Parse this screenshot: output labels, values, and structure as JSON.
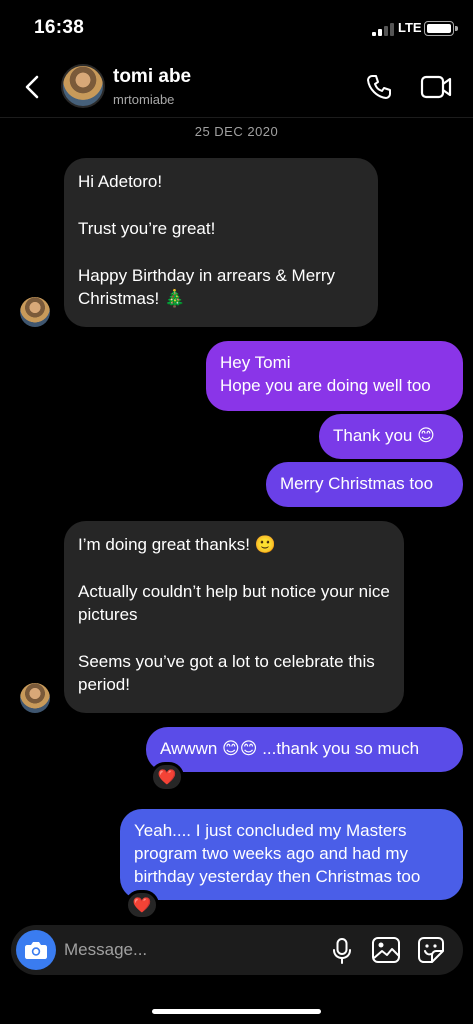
{
  "status_bar": {
    "time": "16:38",
    "network": "LTE"
  },
  "header": {
    "name": "tomi abe",
    "handle": "mrtomiabe"
  },
  "thread": {
    "date": "25 DEC 2020",
    "messages": [
      {
        "dir": "in",
        "lines": [
          "Hi Adetoro!",
          "Trust you’re great!",
          "Happy Birthday in arrears & Merry Christmas! 🎄"
        ]
      },
      {
        "dir": "out",
        "lines": [
          "Hey Tomi",
          "Hope you are doing well too"
        ]
      },
      {
        "dir": "out",
        "lines": [
          "Thank you 😊"
        ]
      },
      {
        "dir": "out",
        "lines": [
          "Merry Christmas too"
        ]
      },
      {
        "dir": "in",
        "lines": [
          "I’m doing great thanks! 🙂",
          "Actually couldn’t help but notice your nice pictures",
          "Seems you’ve got a lot to celebrate this period!"
        ]
      },
      {
        "dir": "out",
        "lines": [
          "Awwwn 😊😊 ...thank you so much"
        ],
        "reaction": "❤️"
      },
      {
        "dir": "out",
        "lines": [
          "Yeah.... I just concluded my Masters program two weeks ago and had my birthday yesterday then Christmas too"
        ],
        "reaction": "❤️"
      }
    ]
  },
  "composer": {
    "placeholder": "Message..."
  },
  "colors": {
    "incoming": "#262626",
    "outgoing_top": "#8a35e8",
    "outgoing_bottom": "#4a5ee8",
    "background": "#000000"
  },
  "icons": [
    "back-arrow-icon",
    "phone-icon",
    "video-camera-icon",
    "camera-icon",
    "microphone-icon",
    "gallery-icon",
    "sticker-icon",
    "heart-icon"
  ]
}
